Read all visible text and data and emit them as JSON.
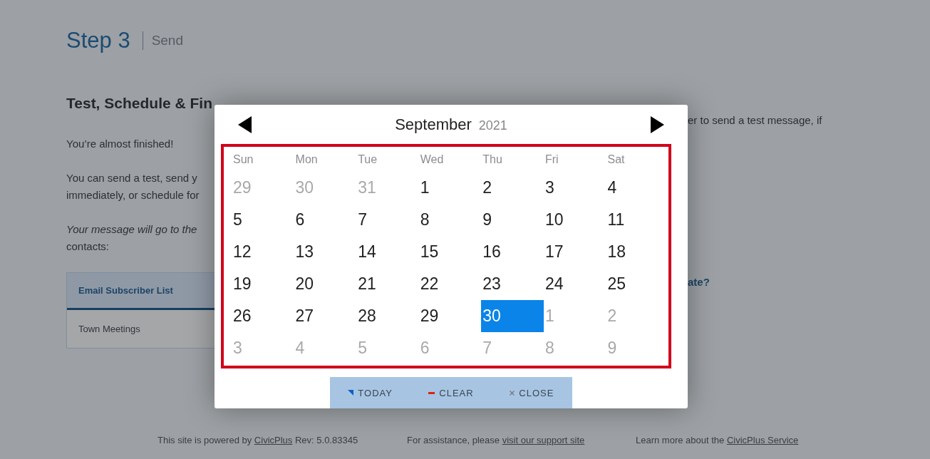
{
  "header": {
    "step": "Step 3",
    "step_name": "Send"
  },
  "section": {
    "heading": "Test, Schedule & Fin",
    "paragraphs": [
      [
        "You’re almost finished!"
      ],
      [
        "You can send a test, send y",
        "immediately, or schedule for"
      ],
      [
        "*Your message will go to the*",
        "contacts:"
      ]
    ],
    "side_texts": [
      {
        "text": "er to send a test message, if",
        "kind": "plain"
      },
      {
        "text": "ate?",
        "kind": "question"
      }
    ]
  },
  "recipients": {
    "tab": {
      "label": "Email Subscriber List",
      "selected": true
    },
    "items": [
      "Town Meetings"
    ]
  },
  "calendar": {
    "month": "September",
    "year": "2021",
    "weekdays": [
      "Sun",
      "Mon",
      "Tue",
      "Wed",
      "Thu",
      "Fri",
      "Sat"
    ],
    "weeks": [
      [
        {
          "day": "29",
          "outside": true,
          "selected": false
        },
        {
          "day": "30",
          "outside": true,
          "selected": false
        },
        {
          "day": "31",
          "outside": true,
          "selected": false
        },
        {
          "day": "1",
          "outside": false,
          "selected": false
        },
        {
          "day": "2",
          "outside": false,
          "selected": false
        },
        {
          "day": "3",
          "outside": false,
          "selected": false
        },
        {
          "day": "4",
          "outside": false,
          "selected": false
        }
      ],
      [
        {
          "day": "5",
          "outside": false,
          "selected": false
        },
        {
          "day": "6",
          "outside": false,
          "selected": false
        },
        {
          "day": "7",
          "outside": false,
          "selected": false
        },
        {
          "day": "8",
          "outside": false,
          "selected": false
        },
        {
          "day": "9",
          "outside": false,
          "selected": false
        },
        {
          "day": "10",
          "outside": false,
          "selected": false
        },
        {
          "day": "11",
          "outside": false,
          "selected": false
        }
      ],
      [
        {
          "day": "12",
          "outside": false,
          "selected": false
        },
        {
          "day": "13",
          "outside": false,
          "selected": false
        },
        {
          "day": "14",
          "outside": false,
          "selected": false
        },
        {
          "day": "15",
          "outside": false,
          "selected": false
        },
        {
          "day": "16",
          "outside": false,
          "selected": false
        },
        {
          "day": "17",
          "outside": false,
          "selected": false
        },
        {
          "day": "18",
          "outside": false,
          "selected": false
        }
      ],
      [
        {
          "day": "19",
          "outside": false,
          "selected": false
        },
        {
          "day": "20",
          "outside": false,
          "selected": false
        },
        {
          "day": "21",
          "outside": false,
          "selected": false
        },
        {
          "day": "22",
          "outside": false,
          "selected": false
        },
        {
          "day": "23",
          "outside": false,
          "selected": false
        },
        {
          "day": "24",
          "outside": false,
          "selected": false
        },
        {
          "day": "25",
          "outside": false,
          "selected": false
        }
      ],
      [
        {
          "day": "26",
          "outside": false,
          "selected": false
        },
        {
          "day": "27",
          "outside": false,
          "selected": false
        },
        {
          "day": "28",
          "outside": false,
          "selected": false
        },
        {
          "day": "29",
          "outside": false,
          "selected": false
        },
        {
          "day": "30",
          "outside": false,
          "selected": true
        },
        {
          "day": "1",
          "outside": true,
          "selected": false
        },
        {
          "day": "2",
          "outside": true,
          "selected": false
        }
      ],
      [
        {
          "day": "3",
          "outside": true,
          "selected": false
        },
        {
          "day": "4",
          "outside": true,
          "selected": false
        },
        {
          "day": "5",
          "outside": true,
          "selected": false
        },
        {
          "day": "6",
          "outside": true,
          "selected": false
        },
        {
          "day": "7",
          "outside": true,
          "selected": false
        },
        {
          "day": "8",
          "outside": true,
          "selected": false
        },
        {
          "day": "9",
          "outside": true,
          "selected": false
        }
      ]
    ],
    "buttons": [
      {
        "kind": "today",
        "label": "TODAY"
      },
      {
        "kind": "clear",
        "label": "CLEAR"
      },
      {
        "kind": "close",
        "label": "CLOSE"
      }
    ]
  },
  "footer": [
    {
      "text": "This site is powered by",
      "link": "CivicPlus",
      "after": "Rev: 5.0.83345"
    },
    {
      "text": "For assistance, please",
      "link": "visit our support site"
    },
    {
      "text": "Learn more about the",
      "link": "CivicPlus Service"
    }
  ]
}
